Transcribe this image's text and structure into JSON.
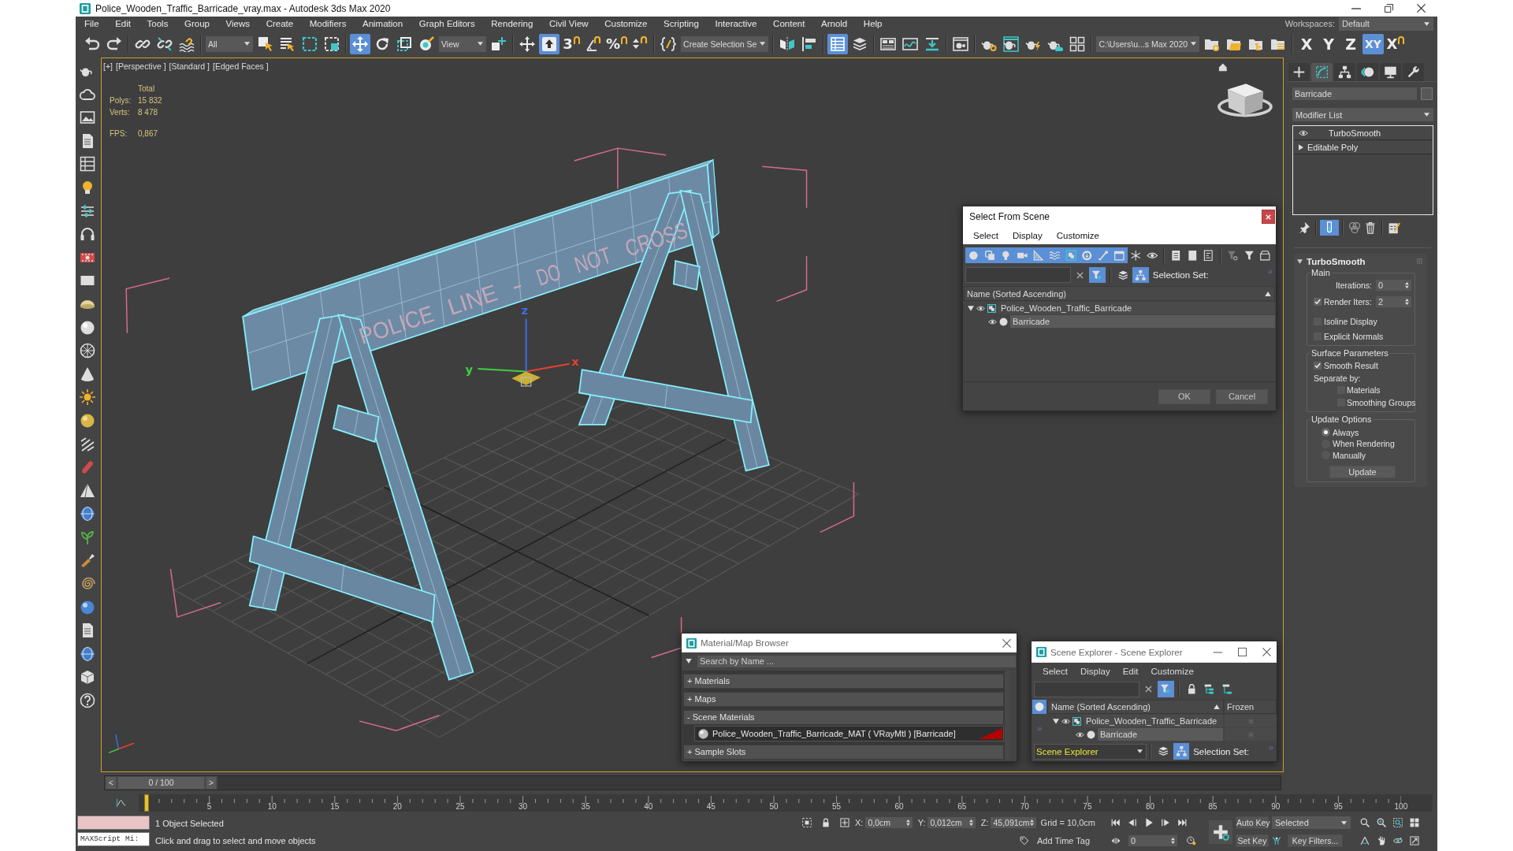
{
  "window": {
    "title": "Police_Wooden_Traffic_Barricade_vray.max - Autodesk 3ds Max 2020"
  },
  "menu": [
    "File",
    "Edit",
    "Tools",
    "Group",
    "Views",
    "Create",
    "Modifiers",
    "Animation",
    "Graph Editors",
    "Rendering",
    "Civil View",
    "Customize",
    "Scripting",
    "Interactive",
    "Content",
    "Arnold",
    "Help"
  ],
  "workspaces": {
    "label": "Workspaces:",
    "value": "Default"
  },
  "toolbar": [
    [
      {
        "kind": "undo",
        "selected": false
      },
      {
        "kind": "redo",
        "selected": false
      }
    ],
    [
      {
        "kind": "link",
        "selected": false
      },
      {
        "kind": "unlink",
        "selected": false
      },
      {
        "kind": "bind",
        "selected": false
      }
    ],
    [
      {
        "kind": "dropdown",
        "value": "All"
      },
      {
        "kind": "select",
        "selected": false
      },
      {
        "kind": "select_by_name",
        "selected": false
      },
      {
        "kind": "region",
        "selected": false
      },
      {
        "kind": "crossing",
        "selected": false
      }
    ],
    [
      {
        "kind": "move",
        "selected": true
      },
      {
        "kind": "rotate",
        "selected": false
      },
      {
        "kind": "scale",
        "selected": false
      },
      {
        "kind": "place",
        "selected": false
      },
      {
        "kind": "dropdown",
        "value": "View"
      },
      {
        "kind": "pivot",
        "selected": false
      }
    ],
    [
      {
        "kind": "manipulate",
        "selected": false
      },
      {
        "kind": "override",
        "selected": true
      },
      {
        "kind": "snap",
        "label": "3",
        "selected": false
      },
      {
        "kind": "angle_snap",
        "selected": false
      },
      {
        "kind": "snap",
        "label": "%",
        "selected": false
      },
      {
        "kind": "spinner_snap",
        "selected": false
      }
    ],
    [
      {
        "kind": "named_sets",
        "selected": false
      },
      {
        "kind": "dropdown",
        "value": "Create Selection Se"
      }
    ],
    [
      {
        "kind": "mirror",
        "selected": false
      },
      {
        "kind": "align",
        "selected": false
      }
    ],
    [
      {
        "kind": "scene_explorer",
        "selected": true
      },
      {
        "kind": "layers",
        "selected": false
      }
    ],
    [
      {
        "kind": "ribbon",
        "selected": false
      },
      {
        "kind": "curve_editor",
        "selected": false
      },
      {
        "kind": "schematic",
        "selected": false
      }
    ],
    [
      {
        "kind": "material_editor",
        "selected": false
      }
    ],
    [
      {
        "kind": "render_setup",
        "selected": false
      },
      {
        "kind": "frame_window",
        "selected": false
      },
      {
        "kind": "render",
        "selected": false
      },
      {
        "kind": "cloud_render",
        "selected": false
      },
      {
        "kind": "a360",
        "selected": false
      }
    ],
    [
      {
        "kind": "dropdown",
        "value": "C:\\Users\\u...s Max 2020"
      },
      {
        "kind": "project_1",
        "selected": false
      },
      {
        "kind": "project_2",
        "selected": false
      },
      {
        "kind": "project_3",
        "selected": false
      },
      {
        "kind": "project_4",
        "selected": false
      }
    ],
    [
      {
        "kind": "axis",
        "label": "X",
        "selected": false
      },
      {
        "kind": "axis",
        "label": "Y",
        "selected": false
      },
      {
        "kind": "axis",
        "label": "Z",
        "selected": false
      },
      {
        "kind": "axis",
        "label": "XY",
        "selected": true
      },
      {
        "kind": "snap",
        "label": "X",
        "selected": false
      }
    ]
  ],
  "viewport": {
    "active": true,
    "labels": [
      "[+]",
      "[Perspective ]",
      "[Standard ]",
      "[Edged Faces ]"
    ],
    "stats": {
      "heading": "Total",
      "rows": [
        {
          "label": "Polys:",
          "value": "15 832"
        },
        {
          "label": "Verts:",
          "value": "8 478"
        }
      ],
      "fps": {
        "label": "FPS:",
        "value": "0,867"
      }
    },
    "model_lettering": [
      "POLICE",
      "LINE",
      "-",
      "DO",
      "NOT",
      "CROSS"
    ],
    "gizmo": [
      {
        "label": "x",
        "color": "#e8402e"
      },
      {
        "label": "y",
        "color": "#3fcf3f"
      },
      {
        "label": "z",
        "color": "#3a6ee8"
      }
    ]
  },
  "select_from_scene": {
    "title": "Select From Scene",
    "menu": [
      "Select",
      "Display",
      "Customize"
    ],
    "filters": [
      {
        "kind": "geometry",
        "selected": true
      },
      {
        "kind": "shapes",
        "selected": true
      },
      {
        "kind": "lights",
        "selected": true
      },
      {
        "kind": "cameras",
        "selected": true
      },
      {
        "kind": "helpers",
        "selected": true
      },
      {
        "kind": "space_warps",
        "selected": true
      },
      {
        "kind": "groups",
        "selected": true
      },
      {
        "kind": "xrefs",
        "selected": true
      },
      {
        "kind": "bones",
        "selected": true
      },
      {
        "kind": "containers",
        "selected": true
      },
      {
        "kind": "frozen",
        "selected": false
      },
      {
        "kind": "hidden",
        "selected": false
      }
    ],
    "toggles": [
      {
        "kind": "filter",
        "selected": true
      },
      {
        "kind": "layers",
        "selected": false
      },
      {
        "kind": "hierarchy",
        "selected": true
      }
    ],
    "selection_set_label": "Selection Set:",
    "overflow": "»",
    "column": "Name (Sorted Ascending)",
    "tree": [
      {
        "name": "Police_Wooden_Traffic_Barricade",
        "kind": "group",
        "expanded": true,
        "selected": false,
        "children": [
          {
            "name": "Barricade",
            "kind": "geometry",
            "selected": true
          }
        ]
      }
    ],
    "buttons": [
      "OK",
      "Cancel"
    ]
  },
  "material_browser": {
    "title": "Material/Map Browser",
    "search": {
      "placeholder": "Search by Name ..."
    },
    "sections": [
      {
        "label": "+ Materials"
      },
      {
        "label": "+ Maps"
      },
      {
        "label": "- Scene Materials",
        "items": [
          {
            "name": "Police_Wooden_Traffic_Barricade_MAT ( VRayMtl ) [Barricade]"
          }
        ]
      },
      {
        "label": "+ Sample Slots"
      }
    ]
  },
  "scene_explorer": {
    "title": "Scene Explorer - Scene Explorer",
    "menu": [
      "Select",
      "Display",
      "Edit",
      "Customize"
    ],
    "toggles": [
      {
        "kind": "filter",
        "selected": true
      },
      {
        "kind": "lock",
        "selected": false
      },
      {
        "kind": "branch_a",
        "selected": false
      },
      {
        "kind": "branch_b",
        "selected": false
      }
    ],
    "columns": [
      "Name (Sorted Ascending)",
      "Frozen"
    ],
    "side_overflow": "»",
    "tree": [
      {
        "name": "Police_Wooden_Traffic_Barricade",
        "kind": "group",
        "expanded": true,
        "selected": false,
        "frozen": false,
        "children": [
          {
            "name": "Barricade",
            "kind": "geometry",
            "selected": true,
            "frozen": false
          }
        ]
      }
    ],
    "explorer": "Scene Explorer",
    "bottom_toggles": [
      {
        "kind": "layers",
        "selected": false
      },
      {
        "kind": "hierarchy",
        "selected": true
      }
    ],
    "selection_set_label": "Selection Set:",
    "bar_overflow": "»"
  },
  "command_panel": {
    "tabs": [
      {
        "kind": "create",
        "selected": false
      },
      {
        "kind": "modify",
        "selected": true
      },
      {
        "kind": "hierarchy",
        "selected": false
      },
      {
        "kind": "motion",
        "selected": false
      },
      {
        "kind": "display",
        "selected": false
      },
      {
        "kind": "utilities",
        "selected": false
      }
    ],
    "object_name": "Barricade",
    "modifier_list": "Modifier List",
    "stack": [
      {
        "kind": "modifier",
        "name": "TurboSmooth"
      },
      {
        "kind": "base",
        "name": "Editable Poly"
      }
    ],
    "show_end_result": true,
    "rollout": {
      "title": "TurboSmooth",
      "expanded": true,
      "groups": [
        {
          "title": "Main",
          "items": [
            {
              "kind": "spinner",
              "label": "Iterations:",
              "value": "0"
            },
            {
              "kind": "check_spinner",
              "label": "Render Iters:",
              "checked": true,
              "value": "2"
            },
            {
              "kind": "checkbox",
              "label": "Isoline Display",
              "checked": false
            },
            {
              "kind": "checkbox",
              "label": "Explicit Normals",
              "checked": false
            }
          ]
        },
        {
          "title": "Surface Parameters",
          "items": [
            {
              "kind": "checkbox",
              "label": "Smooth Result",
              "checked": true
            },
            {
              "kind": "text",
              "label": "Separate by:",
              "children": [
                {
                  "kind": "checkbox",
                  "label": "Materials",
                  "checked": false
                },
                {
                  "kind": "checkbox",
                  "label": "Smoothing Groups",
                  "checked": false
                }
              ]
            }
          ]
        },
        {
          "title": "Update Options",
          "items": [
            {
              "kind": "radio",
              "label": "Always",
              "selected": true
            },
            {
              "kind": "radio",
              "label": "When Rendering",
              "selected": false
            },
            {
              "kind": "radio",
              "label": "Manually",
              "selected": false
            },
            {
              "kind": "button",
              "label": "Update"
            }
          ]
        }
      ]
    }
  },
  "timeline": {
    "prev": "<",
    "frame": "0 / 100",
    "next": ">",
    "level": 0,
    "ruler": [
      "5",
      "10",
      "15",
      "20",
      "25",
      "30",
      "35",
      "40",
      "45",
      "50",
      "55",
      "60",
      "65",
      "70",
      "75",
      "80",
      "85",
      "90",
      "95",
      "100"
    ]
  },
  "status": {
    "listener": "MAXScript Mi:",
    "selection": "1 Object Selected",
    "prompt": "Click and drag to select and move objects",
    "coords": [
      {
        "axis": "X:",
        "value": "0,0cm"
      },
      {
        "axis": "Y:",
        "value": "0,012cm"
      },
      {
        "axis": "Z:",
        "value": "45,091cm"
      }
    ],
    "grid": "Grid = 10,0cm",
    "time_tag": "Add Time Tag",
    "frame": "0",
    "auto_key": "Auto Key",
    "set_key": "Set Key",
    "key_mode": "Selected",
    "key_filters": "Key Filters..."
  }
}
